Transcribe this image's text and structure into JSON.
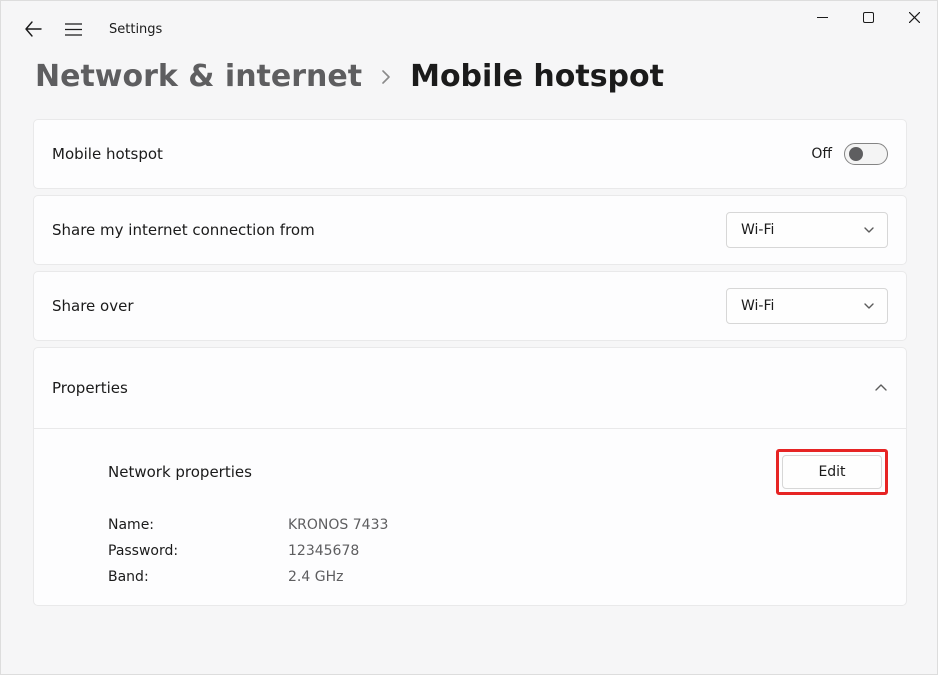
{
  "app": {
    "title": "Settings"
  },
  "breadcrumb": {
    "parent": "Network & internet",
    "current": "Mobile hotspot"
  },
  "rows": {
    "hotspot_toggle": {
      "label": "Mobile hotspot",
      "state": "Off"
    },
    "share_from": {
      "label": "Share my internet connection from",
      "value": "Wi-Fi"
    },
    "share_over": {
      "label": "Share over",
      "value": "Wi-Fi"
    }
  },
  "properties": {
    "header": "Properties",
    "network_properties_label": "Network properties",
    "edit_button": "Edit",
    "fields": {
      "name_label": "Name:",
      "name_value": "KRONOS 7433",
      "password_label": "Password:",
      "password_value": "12345678",
      "band_label": "Band:",
      "band_value": "2.4 GHz"
    }
  }
}
